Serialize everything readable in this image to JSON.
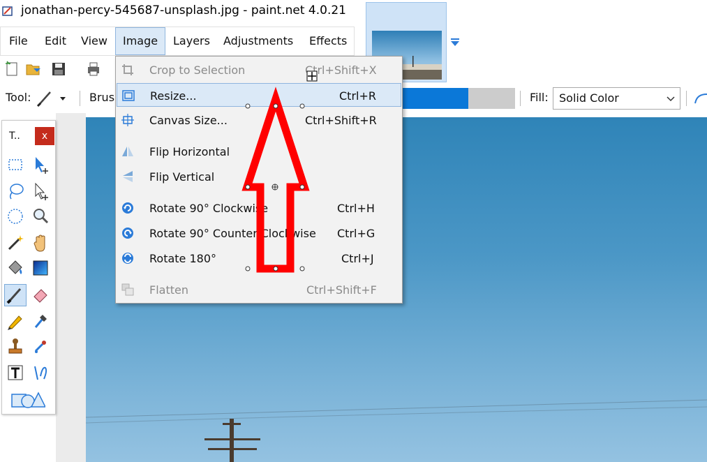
{
  "window": {
    "title": "jonathan-percy-545687-unsplash.jpg - paint.net 4.0.21"
  },
  "menubar": {
    "items": [
      {
        "label": "File"
      },
      {
        "label": "Edit"
      },
      {
        "label": "View"
      },
      {
        "label": "Image",
        "active": true
      },
      {
        "label": "Layers"
      },
      {
        "label": "Adjustments"
      },
      {
        "label": "Effects"
      }
    ]
  },
  "toolbar": {
    "icons": [
      "new-image-icon",
      "open-icon",
      "save-icon",
      "print-icon"
    ]
  },
  "tool_options": {
    "tool_label": "Tool:",
    "brush_label": "Brus",
    "fill_label": "Fill:",
    "fill_value": "Solid Color",
    "slider_fraction": 0.59
  },
  "tools_window": {
    "title": "T..",
    "close_label": "x",
    "tools": [
      "rectangle-select-icon",
      "move-selection-icon",
      "lasso-select-icon",
      "move-selected-icon",
      "ellipse-select-icon",
      "zoom-icon",
      "magic-wand-icon",
      "pan-icon",
      "paint-bucket-icon",
      "gradient-icon",
      "paintbrush-icon",
      "eraser-icon",
      "pencil-icon",
      "color-picker-icon",
      "clone-stamp-icon",
      "recolor-icon",
      "text-icon",
      "line-curve-icon",
      "shapes-icon"
    ]
  },
  "image_menu": {
    "items": [
      {
        "label": "Crop to Selection",
        "shortcut": "Ctrl+Shift+X",
        "disabled": true,
        "icon": "crop-icon"
      },
      {
        "label": "Resize...",
        "shortcut": "Ctrl+R",
        "hover": true,
        "icon": "resize-icon"
      },
      {
        "label": "Canvas Size...",
        "shortcut": "Ctrl+Shift+R",
        "icon": "canvas-size-icon"
      },
      {
        "label": "Flip Horizontal",
        "shortcut": "",
        "icon": "flip-horizontal-icon"
      },
      {
        "label": "Flip Vertical",
        "shortcut": "",
        "icon": "flip-vertical-icon"
      },
      {
        "label": "Rotate 90° Clockwise",
        "shortcut": "Ctrl+H",
        "icon": "rotate-cw-icon"
      },
      {
        "label": "Rotate 90° Counter-Clockwise",
        "shortcut": "Ctrl+G",
        "icon": "rotate-ccw-icon"
      },
      {
        "label": "Rotate 180°",
        "shortcut": "Ctrl+J",
        "icon": "rotate-180-icon"
      },
      {
        "label": "Flatten",
        "shortcut": "Ctrl+Shift+F",
        "disabled": true,
        "icon": "flatten-icon"
      }
    ]
  },
  "colors": {
    "accent": "#0b78d8",
    "annotation_arrow": "#ff0000",
    "close_button": "#c42b1c"
  }
}
